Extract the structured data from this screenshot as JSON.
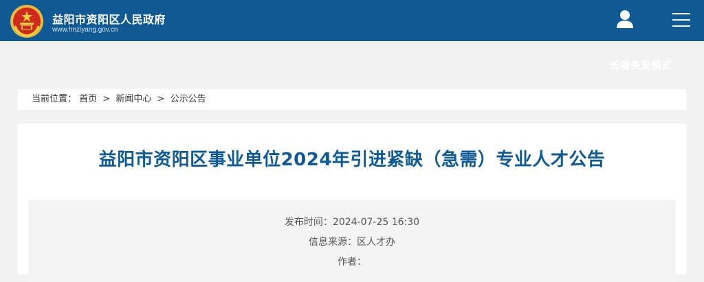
{
  "header": {
    "site_name": "益阳市资阳区人民政府",
    "site_url": "www.hnziyang.gov.cn",
    "bg_color": "#0f5a94",
    "emblem_icon": "national-emblem-icon",
    "user_icon": "user-icon",
    "menu_icon": "hamburger-menu-icon"
  },
  "care_mode_label": "长者关爱模式",
  "breadcrumb": {
    "prefix": "当前位置：",
    "items": [
      "首页",
      "新闻中心",
      "公示公告"
    ],
    "separator": ">"
  },
  "article": {
    "title": "益阳市资阳区事业单位2024年引进紧缺（急需）专业人才公告",
    "title_color": "#0f5a94",
    "meta": {
      "publish_label": "发布时间：",
      "publish_value": "2024-07-25 16:30",
      "source_label": "信息来源：",
      "source_value": "区人才办",
      "author_label": "作者：",
      "author_value": ""
    }
  }
}
